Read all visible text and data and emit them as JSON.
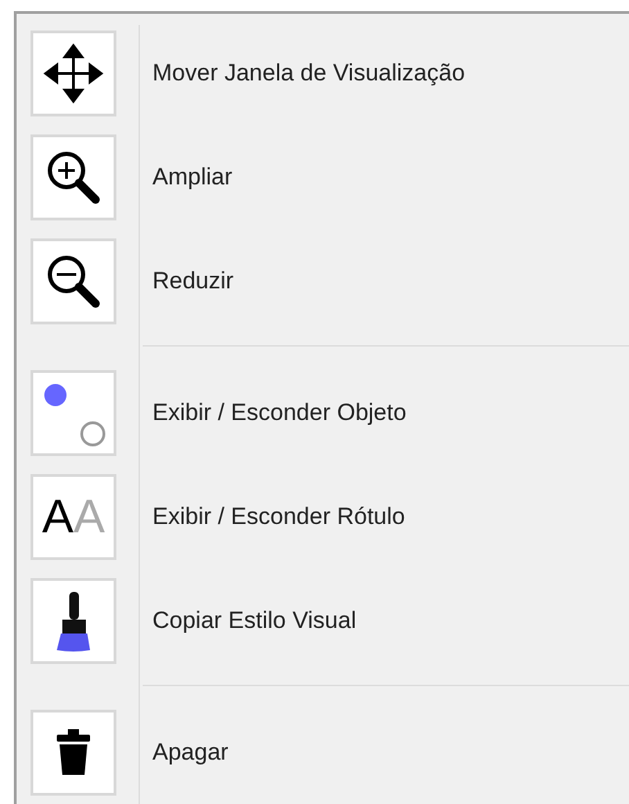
{
  "menu": {
    "sections": [
      {
        "items": [
          {
            "kind": "move",
            "label": "Mover Janela de Visualização"
          },
          {
            "kind": "zoom_in",
            "label": "Ampliar"
          },
          {
            "kind": "zoom_out",
            "label": "Reduzir"
          }
        ]
      },
      {
        "items": [
          {
            "kind": "show_hide_object",
            "label": "Exibir / Esconder Objeto"
          },
          {
            "kind": "show_hide_label",
            "label": "Exibir / Esconder Rótulo",
            "icon_letters": "AA"
          },
          {
            "kind": "copy_style",
            "label": "Copiar Estilo Visual"
          }
        ]
      },
      {
        "items": [
          {
            "kind": "delete",
            "label": "Apagar"
          }
        ]
      }
    ]
  }
}
